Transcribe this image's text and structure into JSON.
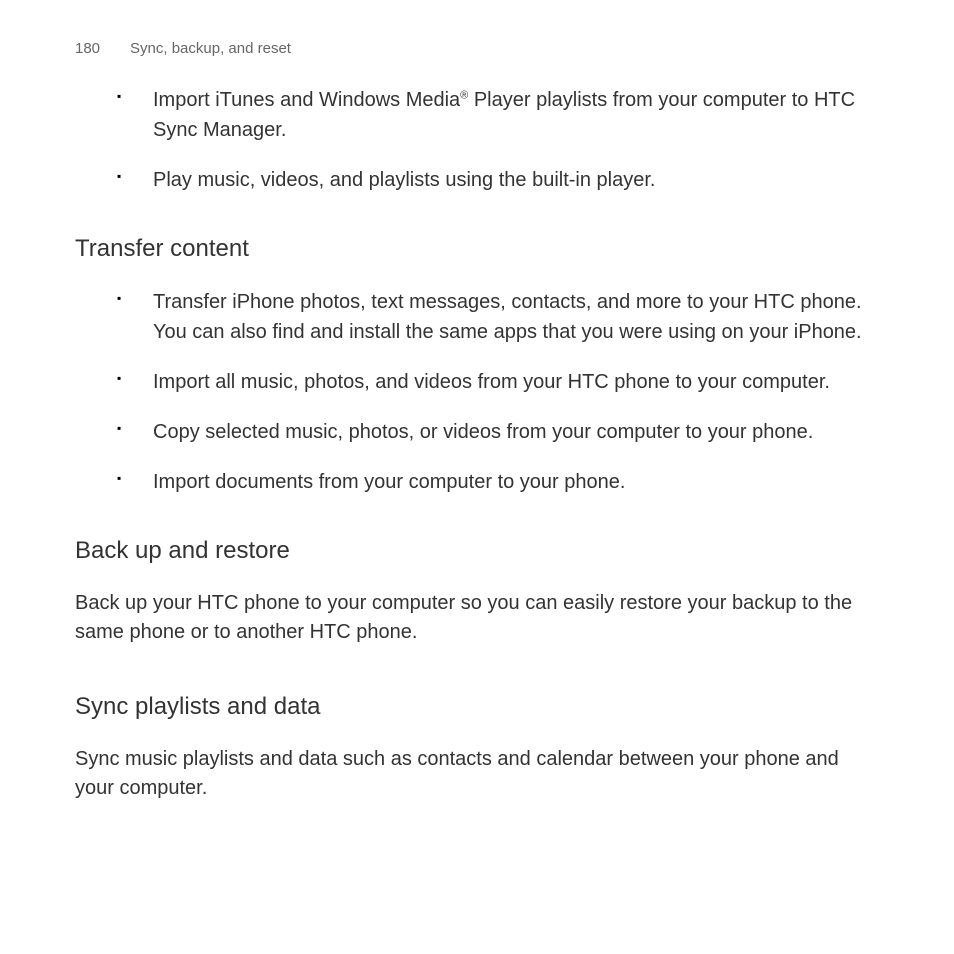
{
  "header": {
    "page_number": "180",
    "breadcrumb": "Sync, backup, and reset"
  },
  "intro_list": {
    "item1_part1": "Import iTunes and Windows Media",
    "item1_sup": "®",
    "item1_part2": " Player playlists from your computer to HTC Sync Manager.",
    "item2": "Play music, videos, and playlists using the built-in player."
  },
  "section_transfer": {
    "heading": "Transfer content",
    "items": {
      "i0": "Transfer iPhone photos, text messages, contacts, and more to your HTC phone. You can also find and install the same apps that you were using on your iPhone.",
      "i1": "Import all music, photos, and videos from your HTC phone to your computer.",
      "i2": "Copy selected music, photos, or videos from your computer to your phone.",
      "i3": "Import documents from your computer to your phone."
    }
  },
  "section_backup": {
    "heading": "Back up and restore",
    "text": "Back up your HTC phone to your computer so you can easily restore your backup to the same phone or to another HTC phone."
  },
  "section_sync": {
    "heading": "Sync playlists and data",
    "text": "Sync music playlists and data such as contacts and calendar between your phone and your computer."
  }
}
